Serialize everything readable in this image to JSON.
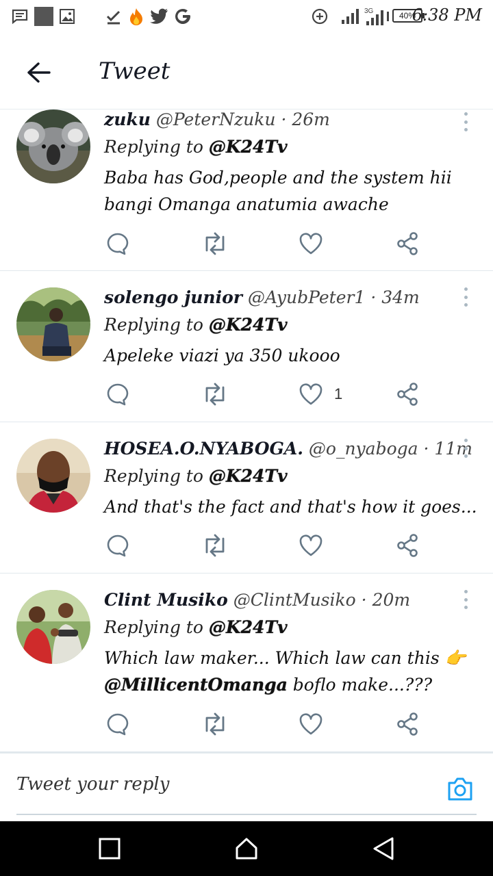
{
  "status_bar": {
    "time": "6:38 PM",
    "battery": "40%",
    "network": "3G",
    "icons": [
      "message-icon",
      "square-icon",
      "image-icon",
      "check-icon",
      "fire-icon",
      "twitter-icon",
      "google-icon",
      "data-saver-icon",
      "signal-icon",
      "signal-3g-icon",
      "vibrate-icon",
      "battery-icon"
    ]
  },
  "header": {
    "title": "Tweet",
    "back_icon": "arrow-left-icon"
  },
  "tweets": [
    {
      "name": "zuku",
      "handle": "@PeterNzuku",
      "dot": "·",
      "time": "26m",
      "replying_prefix": "Replying to",
      "replying_to": "@K24Tv",
      "body": "Baba has God,people and the system hii bangi Omanga anatumia awache",
      "like_count": ""
    },
    {
      "name": "solengo junior",
      "handle": "@AyubPeter1",
      "dot": "·",
      "time": "34m",
      "replying_prefix": "Replying to",
      "replying_to": "@K24Tv",
      "body": "Apeleke viazi ya 350 ukooo",
      "like_count": "1"
    },
    {
      "name": "HOSEA.O.NYABOGA.",
      "handle": "@o_nyaboga",
      "dot": "·",
      "time": "11m",
      "replying_prefix": "Replying to",
      "replying_to": "@K24Tv",
      "body": "And that's the fact and that's how it goes...",
      "like_count": ""
    },
    {
      "name": "Clint Musiko",
      "handle": "@ClintMusiko",
      "dot": "·",
      "time": "20m",
      "replying_prefix": "Replying to",
      "replying_to": "@K24Tv",
      "body_part1": "Which law maker... Which law can this 👉",
      "body_mention": "@MillicentOmanga",
      "body_part2": " boflo make...???",
      "like_count": ""
    }
  ],
  "reply_bar": {
    "placeholder": "Tweet your reply",
    "camera_icon": "camera-icon"
  },
  "colors": {
    "accent": "#1da1f2",
    "icon_gray": "#657786",
    "divider": "#e1e8ed",
    "nav_bg": "#000000"
  },
  "nav_bar": {
    "icons": [
      "recents-square-icon",
      "home-icon",
      "back-triangle-icon"
    ]
  }
}
